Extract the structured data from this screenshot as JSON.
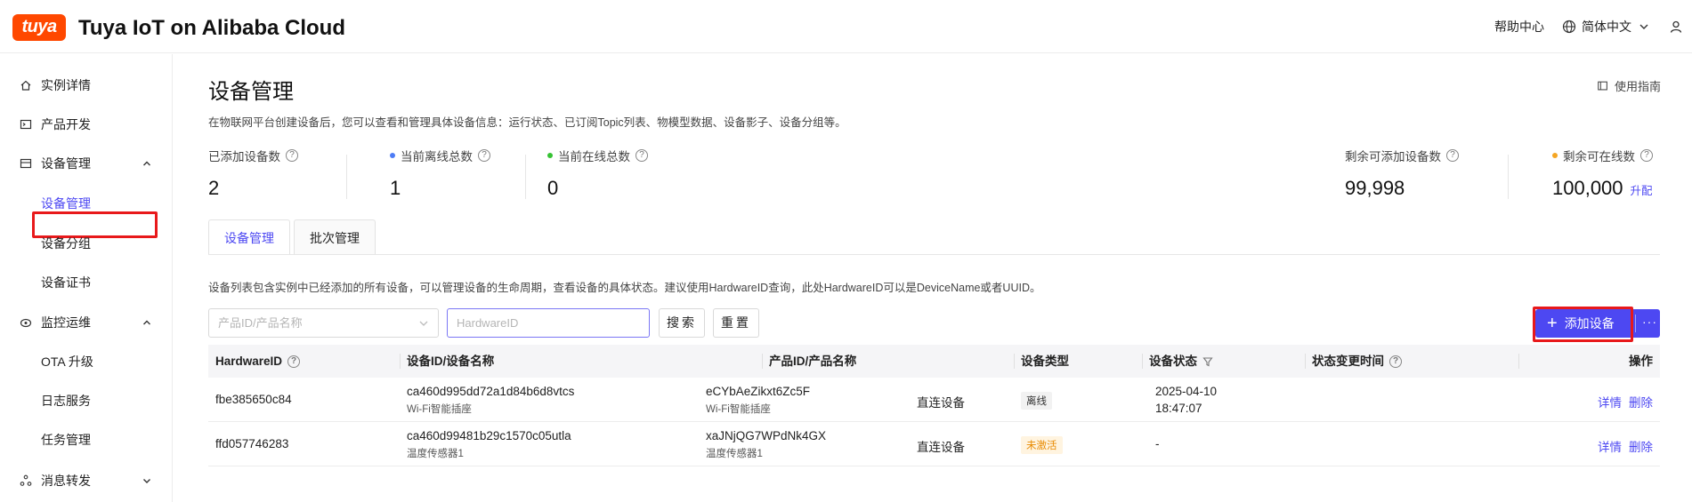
{
  "header": {
    "logo_text": "tuya",
    "brand": "Tuya IoT on Alibaba Cloud",
    "help": "帮助中心",
    "language": "简体中文"
  },
  "sidebar": {
    "items": [
      {
        "label": "实例详情",
        "icon": "home-icon"
      },
      {
        "label": "产品开发",
        "icon": "terminal-icon"
      },
      {
        "label": "设备管理",
        "icon": "device-list-icon",
        "expanded": true
      },
      {
        "label": "设备管理",
        "sub": true,
        "active": true
      },
      {
        "label": "设备分组",
        "sub": true
      },
      {
        "label": "设备证书",
        "sub": true
      },
      {
        "label": "监控运维",
        "icon": "monitor-icon",
        "expanded": true
      },
      {
        "label": "OTA 升级",
        "sub": true
      },
      {
        "label": "日志服务",
        "sub": true
      },
      {
        "label": "任务管理",
        "sub": true
      },
      {
        "label": "消息转发",
        "icon": "message-forward-icon",
        "expanded": false
      }
    ]
  },
  "page": {
    "title": "设备管理",
    "guide": "使用指南",
    "description": "在物联网平台创建设备后，您可以查看和管理具体设备信息：运行状态、已订阅Topic列表、物模型数据、设备影子、设备分组等。"
  },
  "stats": {
    "added": {
      "label": "已添加设备数",
      "value": "2"
    },
    "offline": {
      "label": "当前离线总数",
      "value": "1",
      "dot": "#4d7cf5"
    },
    "online": {
      "label": "当前在线总数",
      "value": "0",
      "dot": "#36c233"
    },
    "remaining_add": {
      "label": "剩余可添加设备数",
      "value": "99,998"
    },
    "remaining_online": {
      "label": "剩余可在线数",
      "value": "100,000",
      "dot": "#f5a623",
      "action": "升配"
    }
  },
  "tabs": [
    "设备管理",
    "批次管理"
  ],
  "list": {
    "description": "设备列表包含实例中已经添加的所有设备，可以管理设备的生命周期，查看设备的具体状态。建议使用HardwareID查询，此处HardwareID可以是DeviceName或者UUID。",
    "product_placeholder": "产品ID/产品名称",
    "hardware_placeholder": "HardwareID",
    "search": "搜索",
    "reset": "重置",
    "add_device": "添加设备",
    "more": "···"
  },
  "table": {
    "headers": [
      "HardwareID",
      "设备ID/设备名称",
      "产品ID/产品名称",
      "设备类型",
      "设备状态",
      "状态变更时间",
      "操作"
    ],
    "rows": [
      {
        "hardware_id": "fbe385650c84",
        "device_id": "ca460d995dd72a1d84b6d8vtcs",
        "device_name": "Wi-Fi智能插座",
        "product_id": "eCYbAeZikxt6Zc5F",
        "product_name": "Wi-Fi智能插座",
        "type": "直连设备",
        "status": "离线",
        "time_date": "2025-04-10",
        "time_clock": "18:47:07",
        "detail": "详情",
        "delete": "删除"
      },
      {
        "hardware_id": "ffd057746283",
        "device_id": "ca460d99481b29c1570c05utla",
        "device_name": "温度传感器1",
        "product_id": "xaJNjQG7WPdNk4GX",
        "product_name": "温度传感器1",
        "type": "直连设备",
        "status": "未激活",
        "time_date": "-",
        "time_clock": "",
        "detail": "详情",
        "delete": "删除"
      }
    ]
  },
  "colors": {
    "accent": "#4d48f2",
    "brand": "#ff4800",
    "highlight": "#e8191b"
  }
}
